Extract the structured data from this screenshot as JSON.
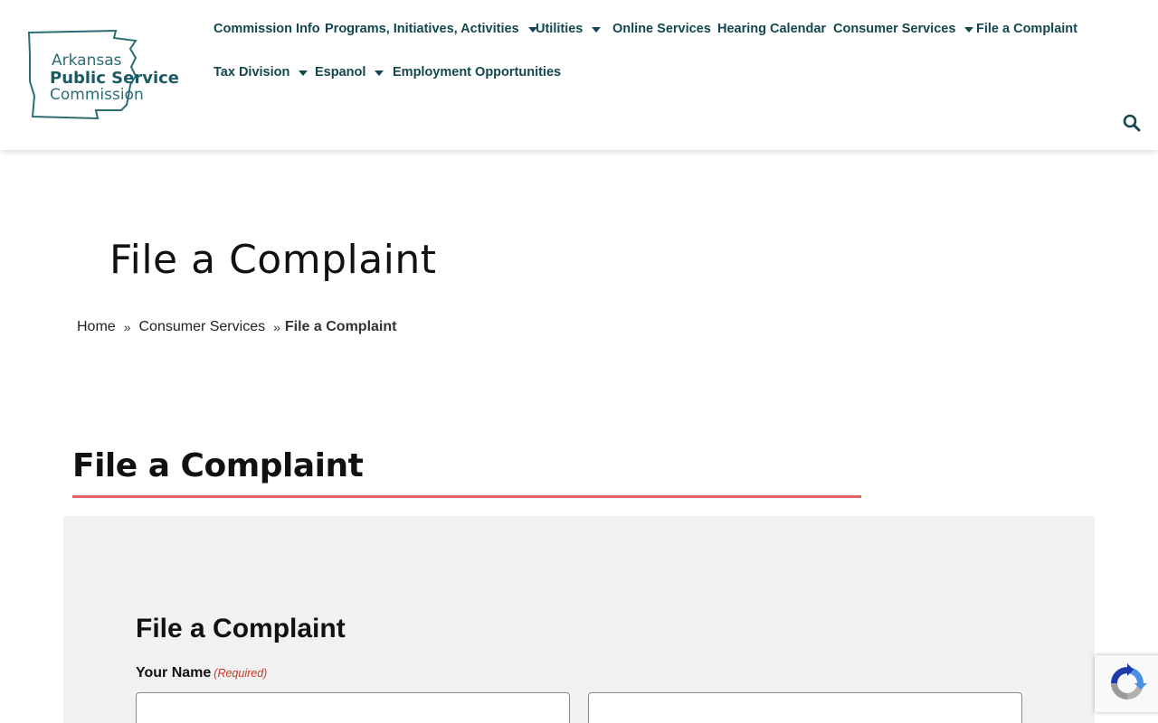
{
  "logo": {
    "line1": "Arkansas",
    "line2": "Public Service",
    "line3": "Commission"
  },
  "nav": {
    "items": [
      {
        "label": "Commission Info",
        "has_dropdown": false
      },
      {
        "label": "Programs, Initiatives, Activities",
        "has_dropdown": true
      },
      {
        "label": "Utilities",
        "has_dropdown": true
      },
      {
        "label": "Online Services",
        "has_dropdown": false
      },
      {
        "label": "Hearing Calendar",
        "has_dropdown": false
      },
      {
        "label": "Consumer Services",
        "has_dropdown": true
      },
      {
        "label": "File a Complaint",
        "has_dropdown": false
      },
      {
        "label": "Tax Division",
        "has_dropdown": true
      },
      {
        "label": "Espanol",
        "has_dropdown": true
      },
      {
        "label": "Employment Opportunities",
        "has_dropdown": false
      }
    ],
    "search_icon": "search-icon"
  },
  "page": {
    "title": "File a Complaint"
  },
  "breadcrumb": {
    "items": [
      "Home",
      "Consumer Services",
      "File a Complaint"
    ],
    "separator": "»"
  },
  "section": {
    "heading": "File a Complaint"
  },
  "form": {
    "title": "File a Complaint",
    "name_label": "Your Name",
    "required_text": "(Required)",
    "first_name_value": "",
    "last_name_value": ""
  },
  "colors": {
    "brand_teal": "#1c5a63",
    "nav_text": "#12474f",
    "accent_rule": "#e0625c",
    "panel_bg": "#f1f1f1",
    "required": "#c0392b"
  }
}
